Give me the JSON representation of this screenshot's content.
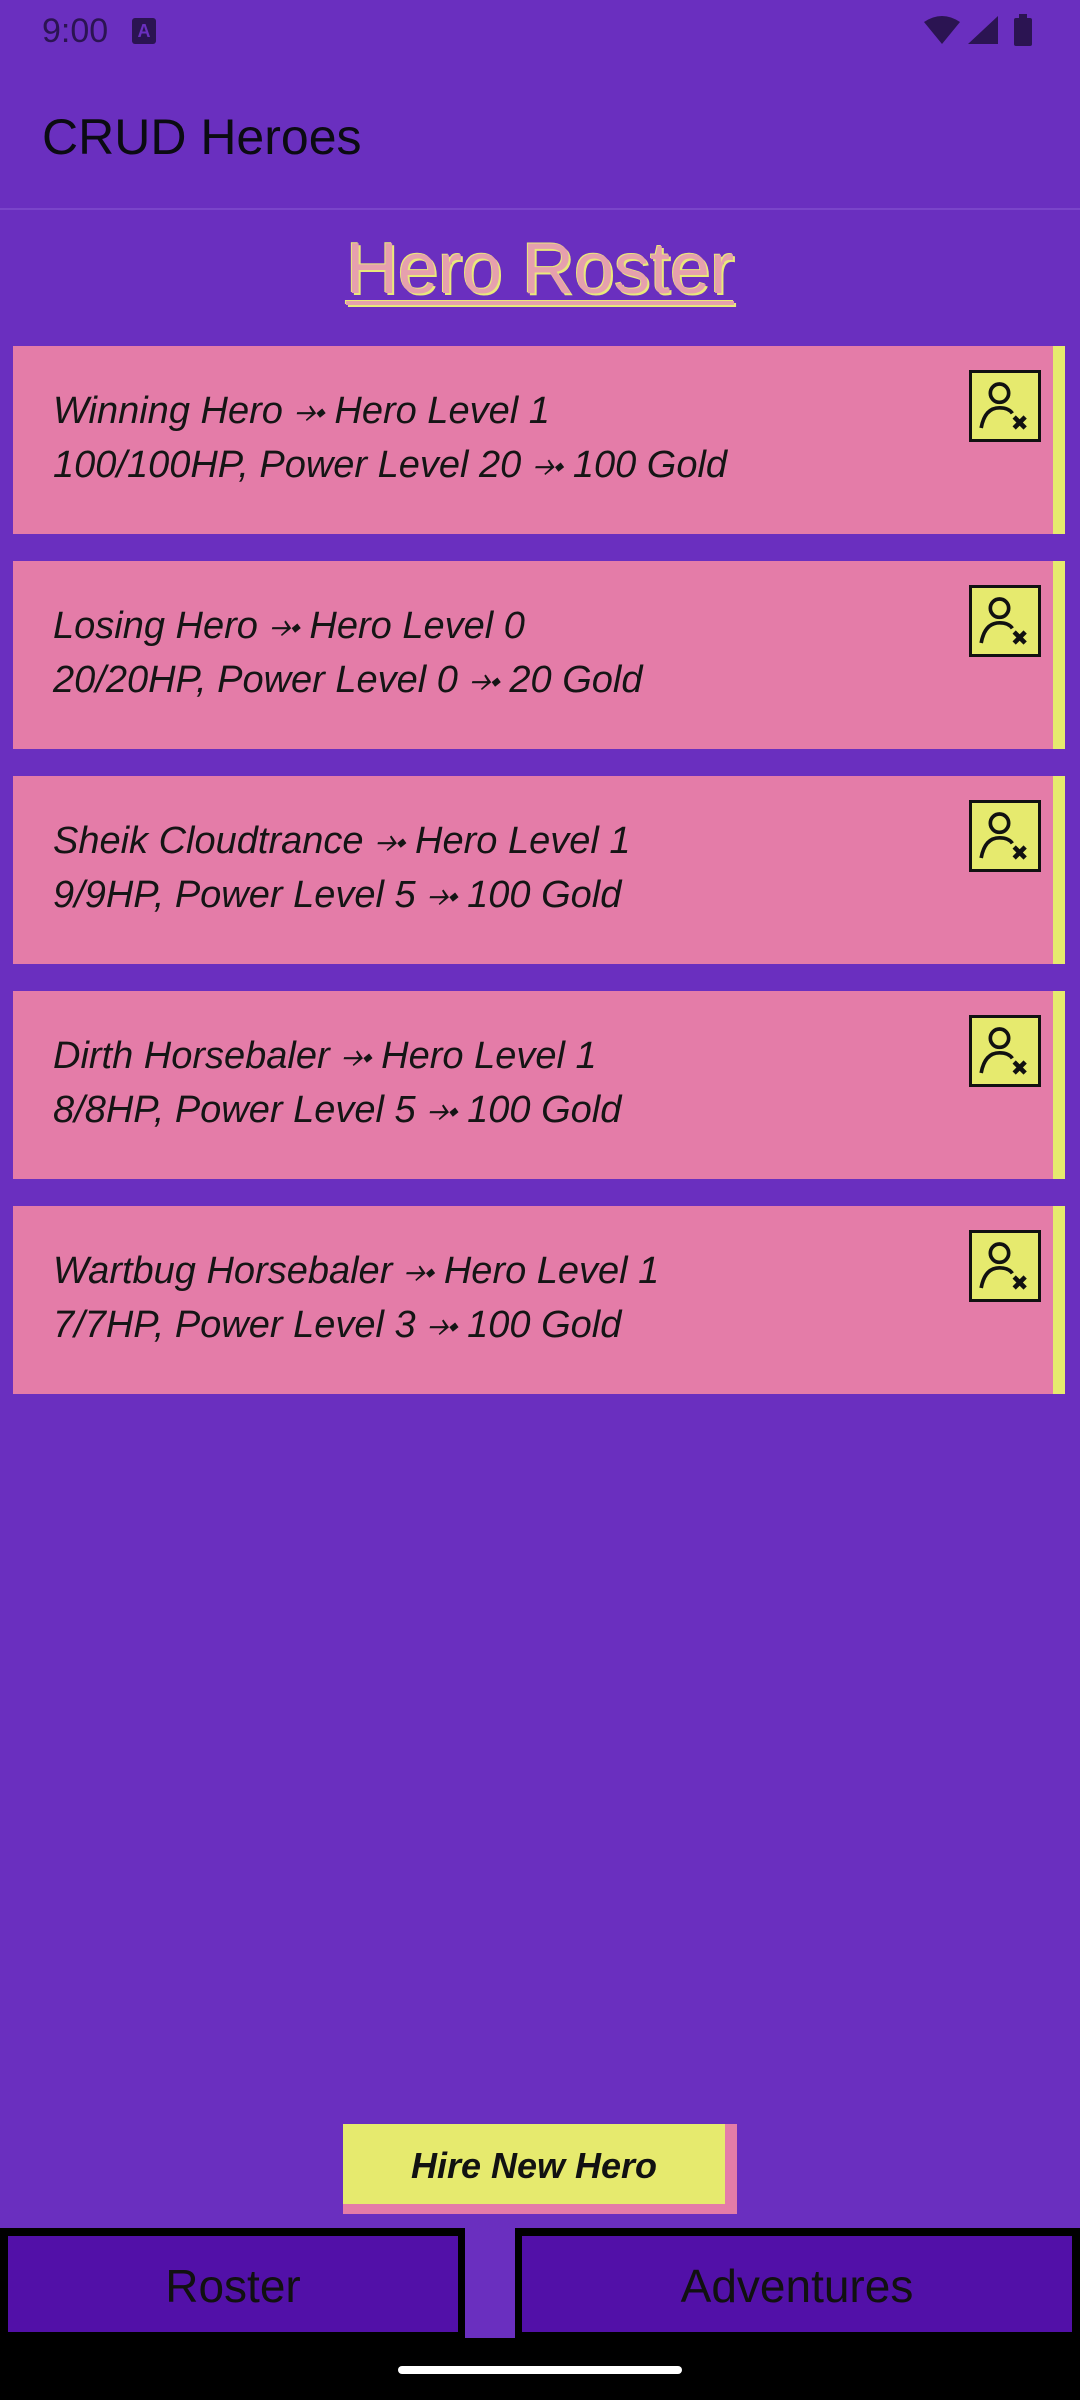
{
  "status_bar": {
    "time": "9:00",
    "notification_icon": "A",
    "icons": [
      "wifi-icon",
      "signal-icon",
      "battery-icon"
    ]
  },
  "app_bar": {
    "title": "CRUD Heroes"
  },
  "page": {
    "heading": "Hero Roster"
  },
  "heroes": [
    {
      "line1": "Winning Hero ⤞ Hero Level 1",
      "line2": "100/100HP, Power Level 20 ⤞ 100 Gold",
      "delete_icon": "remove-user-icon"
    },
    {
      "line1": "Losing Hero ⤞ Hero Level 0",
      "line2": "20/20HP, Power Level 0 ⤞ 20 Gold",
      "delete_icon": "remove-user-icon"
    },
    {
      "line1": "Sheik Cloudtrance ⤞ Hero Level 1",
      "line2": "9/9HP, Power Level 5 ⤞ 100 Gold",
      "delete_icon": "remove-user-icon"
    },
    {
      "line1": "Dirth Horsebaler ⤞ Hero Level 1",
      "line2": "8/8HP, Power Level 5 ⤞ 100 Gold",
      "delete_icon": "remove-user-icon"
    },
    {
      "line1": "Wartbug Horsebaler ⤞ Hero Level 1",
      "line2": "7/7HP, Power Level 3 ⤞ 100 Gold",
      "delete_icon": "remove-user-icon"
    }
  ],
  "actions": {
    "hire_label": "Hire New Hero"
  },
  "bottom_nav": {
    "roster_label": "Roster",
    "adventures_label": "Adventures"
  },
  "colors": {
    "background": "#6a2fbf",
    "card": "#e47ca8",
    "accent_yellow": "#e6ea6e",
    "nav_button": "#5210a8"
  }
}
